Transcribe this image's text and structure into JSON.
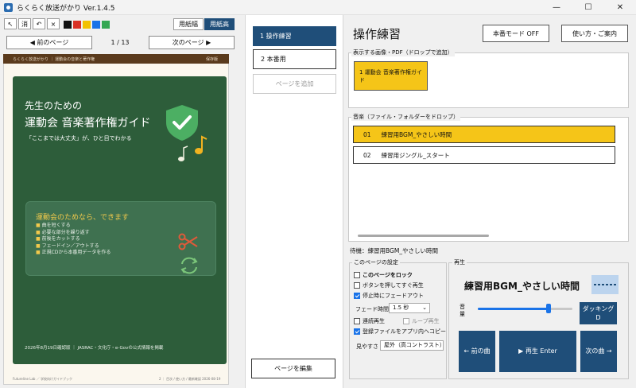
{
  "window": {
    "title": "らくらく放送がかり Ver.1.4.5",
    "minimize": "—",
    "maximize": "☐",
    "close": "✕"
  },
  "toolbar": {
    "tools": [
      "↖",
      "消",
      "↶",
      "×"
    ],
    "colors": [
      "#111111",
      "#d93025",
      "#f2c200",
      "#1a73e8",
      "#34a853"
    ],
    "paper_width": "用紙幅",
    "paper_height": "用紙高"
  },
  "viewer": {
    "prev": "◀ 前のページ",
    "next": "次のページ ▶",
    "page_indicator": "1 / 13"
  },
  "document": {
    "header_left": "らくらく放送がかり ｜ 運動会の音楽と著作権",
    "header_right": "保存版",
    "title_line1": "先生のための",
    "title_line2": "運動会 音楽著作権ガイド",
    "subtitle": "「ここまでは大丈夫」が、ひと目でわかる",
    "feature_title": "運動会のためなら、できます",
    "features": [
      "曲を短くする",
      "必要な部分を繰り返す",
      "前後をカットする",
      "フェードイン／アウトする",
      "正規CDから本番用データを作る"
    ],
    "footnote": "2026年8月19日確認版 ｜ JASRAC・文化庁・e-Govの公式情報を掲載",
    "footer_left": "Futureline Lab ／ 学校向けガイドブック",
    "footer_right": "2 ｜ 目次 / 使い方 / 最新確認 2026-08-19"
  },
  "pages": {
    "items": [
      {
        "label": "1  操作練習",
        "selected": true
      },
      {
        "label": "2  本番用",
        "selected": false
      }
    ],
    "add_page": "ページを追加",
    "edit_page": "ページを編集"
  },
  "main": {
    "title": "操作練習",
    "mode_button": "本番モード OFF",
    "help_button": "使い方・ご案内",
    "image_section_label": "表示する画像・PDF（ドロップで追加）",
    "image_item": "1  運動会 音楽著作権ガイド",
    "music_section_label": "音楽（ファイル・フォルダーをドロップ）",
    "tracks": [
      {
        "num": "01",
        "name": "練習用BGM_やさしい時間",
        "selected": true
      },
      {
        "num": "02",
        "name": "練習用ジングル_スタート",
        "selected": false
      }
    ],
    "status": "待機：練習用BGM_やさしい時間"
  },
  "settings": {
    "label": "このページの設定",
    "lock": {
      "label": "このページをロック",
      "checked": false
    },
    "instant_play": {
      "label": "ボタンを押してすぐ再生",
      "checked": false
    },
    "fade_on_stop": {
      "label": "停止時にフェードアウト",
      "checked": true
    },
    "fade_time_label": "フェード時間",
    "fade_time_value": "1.5 秒",
    "continuous": {
      "label": "連続再生",
      "checked": false
    },
    "loop": {
      "label": "ループ再生",
      "checked": false
    },
    "copy_files": {
      "label": "登録ファイルをアプリ内へコピー",
      "checked": true
    },
    "view_label": "見やすさ",
    "view_value": "屋外（高コントラスト）"
  },
  "playback": {
    "label": "再生",
    "now_playing": "練習用BGM_やさしい時間",
    "volume_label": "音量",
    "volume_level": 0.75,
    "ducking": "ダッキング",
    "ducking_key": "D",
    "prev_song": "← 前の曲",
    "play": "▶ 再生  Enter",
    "next_song": "次の曲 →"
  }
}
